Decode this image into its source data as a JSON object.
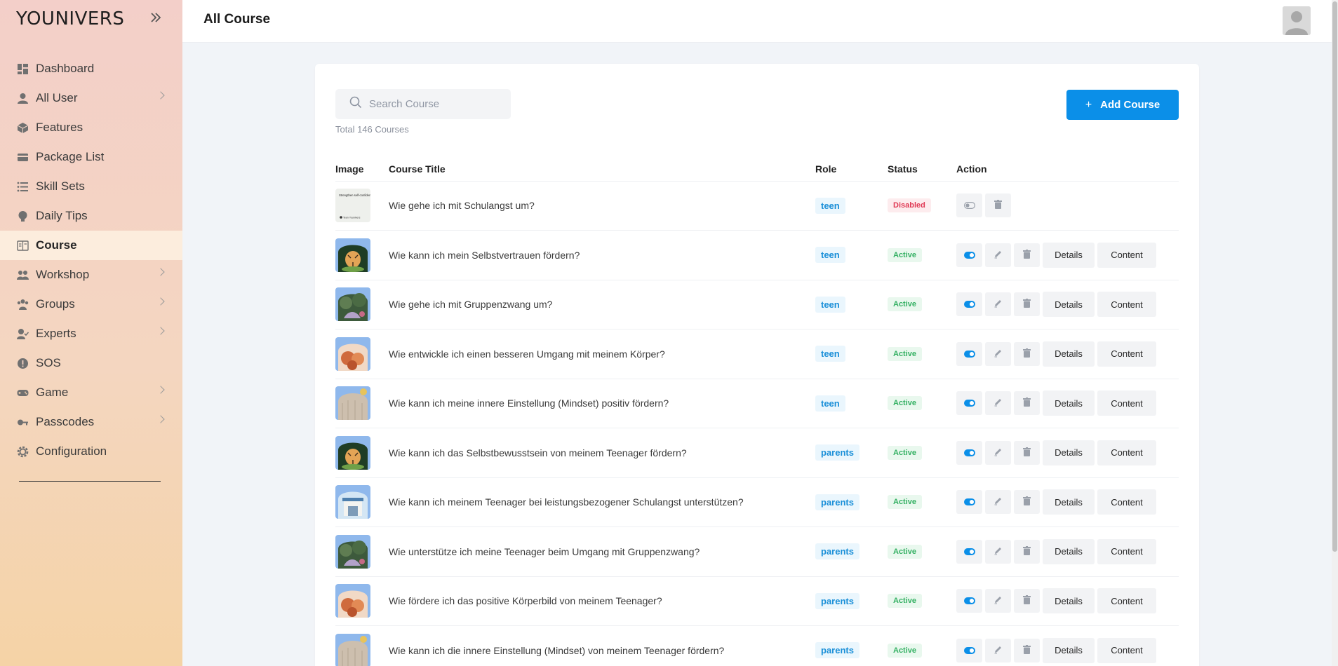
{
  "brand": "YOUNIVERS",
  "page_title": "All Course",
  "sidebar": {
    "items": [
      {
        "label": "Dashboard",
        "icon": "dashboard-icon",
        "chevron": false,
        "active": false
      },
      {
        "label": "All User",
        "icon": "user-icon",
        "chevron": true,
        "active": false
      },
      {
        "label": "Features",
        "icon": "cube-icon",
        "chevron": false,
        "active": false
      },
      {
        "label": "Package List",
        "icon": "card-icon",
        "chevron": false,
        "active": false
      },
      {
        "label": "Skill Sets",
        "icon": "list-icon",
        "chevron": false,
        "active": false
      },
      {
        "label": "Daily Tips",
        "icon": "lightbulb-icon",
        "chevron": false,
        "active": false
      },
      {
        "label": "Course",
        "icon": "course-icon",
        "chevron": false,
        "active": true
      },
      {
        "label": "Workshop",
        "icon": "group-icon",
        "chevron": true,
        "active": false
      },
      {
        "label": "Groups",
        "icon": "groups-icon",
        "chevron": true,
        "active": false
      },
      {
        "label": "Experts",
        "icon": "expert-icon",
        "chevron": true,
        "active": false
      },
      {
        "label": "SOS",
        "icon": "alert-icon",
        "chevron": false,
        "active": false
      },
      {
        "label": "Game",
        "icon": "gamepad-icon",
        "chevron": true,
        "active": false
      },
      {
        "label": "Passcodes",
        "icon": "key-icon",
        "chevron": true,
        "active": false
      },
      {
        "label": "Configuration",
        "icon": "gear-icon",
        "chevron": false,
        "active": false
      }
    ]
  },
  "search": {
    "placeholder": "Search Course"
  },
  "total_label": "Total 146 Courses",
  "add_button_label": "Add Course",
  "table": {
    "headers": {
      "image": "Image",
      "title": "Course Title",
      "role": "Role",
      "status": "Status",
      "action": "Action"
    },
    "details_label": "Details",
    "content_label": "Content",
    "rows": [
      {
        "title": "Wie gehe ich mit Schulangst um?",
        "role": "teen",
        "status": "Disabled",
        "thumb": "text"
      },
      {
        "title": "Wie kann ich mein Selbstvertrauen fördern?",
        "role": "teen",
        "status": "Active",
        "thumb": "tiger"
      },
      {
        "title": "Wie gehe ich mit Gruppenzwang um?",
        "role": "teen",
        "status": "Active",
        "thumb": "forest"
      },
      {
        "title": "Wie entwickle ich einen besseren Umgang mit meinem Körper?",
        "role": "teen",
        "status": "Active",
        "thumb": "warm"
      },
      {
        "title": "Wie kann ich meine innere Einstellung (Mindset) positiv fördern?",
        "role": "teen",
        "status": "Active",
        "thumb": "rock"
      },
      {
        "title": "Wie kann ich das Selbstbewusstsein von meinem Teenager fördern?",
        "role": "parents",
        "status": "Active",
        "thumb": "tiger"
      },
      {
        "title": "Wie kann ich meinem Teenager bei leistungsbezogener Schulangst unterstützen?",
        "role": "parents",
        "status": "Active",
        "thumb": "building"
      },
      {
        "title": "Wie unterstütze ich meine Teenager beim Umgang mit Gruppenzwang?",
        "role": "parents",
        "status": "Active",
        "thumb": "forest"
      },
      {
        "title": "Wie fördere ich das positive Körperbild von meinem Teenager?",
        "role": "parents",
        "status": "Active",
        "thumb": "warm"
      },
      {
        "title": "Wie kann ich die innere Einstellung (Mindset) von meinem Teenager fördern?",
        "role": "parents",
        "status": "Active",
        "thumb": "rock"
      }
    ]
  },
  "thumb_text": "Strengthen self-confidence",
  "thumb_subtext": "Teen Younivers",
  "colors": {
    "accent": "#0b8fe8",
    "active_text": "#33b062",
    "disabled_text": "#e03a55",
    "role_text": "#1a8fd8"
  }
}
